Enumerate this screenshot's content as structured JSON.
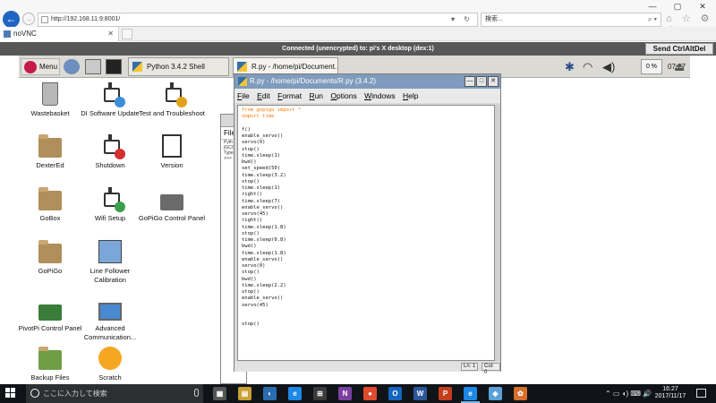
{
  "browser": {
    "address": "http://192.168.11.9:8001/",
    "search_placeholder": "検索...",
    "tab_title": "noVNC",
    "address_controls": "▾ ↻",
    "search_controls": "⌕ ▾",
    "toolbar_icons": "⌂ ☆ ⚙ ☺",
    "window_controls": [
      "—",
      "▢",
      "✕"
    ]
  },
  "vnc": {
    "status": "Connected (unencrypted) to: pi's X desktop (dex:1)",
    "send_ctrl_alt_del": "Send CtrlAltDel"
  },
  "panel": {
    "menu_label": "Menu",
    "tasks": [
      "Python 3.4.2 Shell",
      "R.py - /home/pi/Document..."
    ],
    "cpu": "0 %",
    "clock": "07:27"
  },
  "desktop_icons": [
    {
      "label": "Wastebasket"
    },
    {
      "label": "DI Software Update"
    },
    {
      "label": "Test and Troubleshoot"
    },
    {
      "label": "DexterEd"
    },
    {
      "label": "Shutdown"
    },
    {
      "label": "Version"
    },
    {
      "label": "GoBox"
    },
    {
      "label": "Wifi Setup"
    },
    {
      "label": "GoPiGo Control Panel"
    },
    {
      "label": "GoPiGo"
    },
    {
      "label": "Line Follower Calibration"
    },
    {
      "label": "PivotPi Control Panel"
    },
    {
      "label": "Advanced Communication..."
    },
    {
      "label": "Backup Files"
    },
    {
      "label": "Scratch"
    }
  ],
  "shell": {
    "menu": "File",
    "lines": [
      "Pyth",
      "[GCC",
      "Type",
      ">>>"
    ]
  },
  "idle": {
    "title": "R.py - /home/pi/Documents/R.py (3.4.2)",
    "menu": [
      "File",
      "Edit",
      "Format",
      "Run",
      "Options",
      "Windows",
      "Help"
    ],
    "code": [
      "from gopigo import *",
      "import time",
      "",
      "f()",
      "enable_servo()",
      "servo(0)",
      "stop()",
      "time.sleep(1)",
      "bwd()",
      "set_speed(50)",
      "time.sleep(3.2)",
      "stop()",
      "time.sleep(1)",
      "right()",
      "time.sleep(7)",
      "enable_servo()",
      "servo(45)",
      "right()",
      "time.sleep(1.8)",
      "stop()",
      "time.sleep(0.8)",
      "bwd()",
      "time.sleep(1.8)",
      "enable_servo()",
      "servo(0)",
      "stop()",
      "bwd()",
      "time.sleep(2.2)",
      "stop()",
      "enable_servo()",
      "servo(45)",
      "",
      "",
      "stop()"
    ],
    "status_ln": "Ln: 1",
    "status_col": "Col: 0"
  },
  "taskbar": {
    "search": "ここに入力して検索",
    "apps": [
      "▦",
      "▤",
      "◐",
      "e",
      "⊞",
      "N",
      "●",
      "O",
      "W",
      "P",
      "e",
      "◈",
      "✿"
    ],
    "tray_icons": "⌃ ▭ ◖) ⌨ 🔊",
    "time": "16:27",
    "date": "2017/11/17"
  }
}
